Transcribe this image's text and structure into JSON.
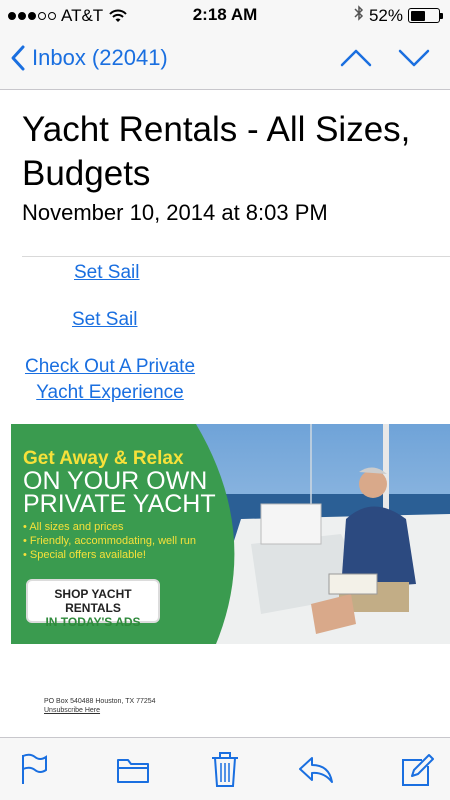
{
  "status_bar": {
    "carrier": "AT&T",
    "time": "2:18 AM",
    "battery_percent": "52%",
    "battery_level": 0.52
  },
  "nav": {
    "back_label": "Inbox (22041)"
  },
  "email": {
    "subject": "Yacht Rentals - All Sizes, Budgets",
    "date": "November 10, 2014 at 8:03 PM"
  },
  "links": {
    "set_sail_1": "Set Sail",
    "set_sail_2": "Set Sail",
    "check_out": "Check Out A Private Yacht Experience"
  },
  "ad": {
    "headline_1": "Get Away & Relax",
    "headline_2": "ON YOUR OWN",
    "headline_3": "PRIVATE YACHT",
    "bullets": [
      "All sizes and prices",
      "Friendly, accommodating, well run",
      "Special offers available!"
    ],
    "cta_line_1": "SHOP YACHT RENTALS",
    "cta_line_2": "IN TODAY'S ADS"
  },
  "footer": {
    "address": "PO Box 540488 Houston, TX 77254",
    "unsubscribe": "Unsubscribe Here"
  },
  "toolbar": {
    "icons": [
      "flag-icon",
      "folder-icon",
      "trash-icon",
      "reply-icon",
      "compose-icon"
    ]
  },
  "colors": {
    "accent": "#1a6fe0",
    "ad_green": "#3a9b4f",
    "ad_yellow": "#f6e13a"
  }
}
